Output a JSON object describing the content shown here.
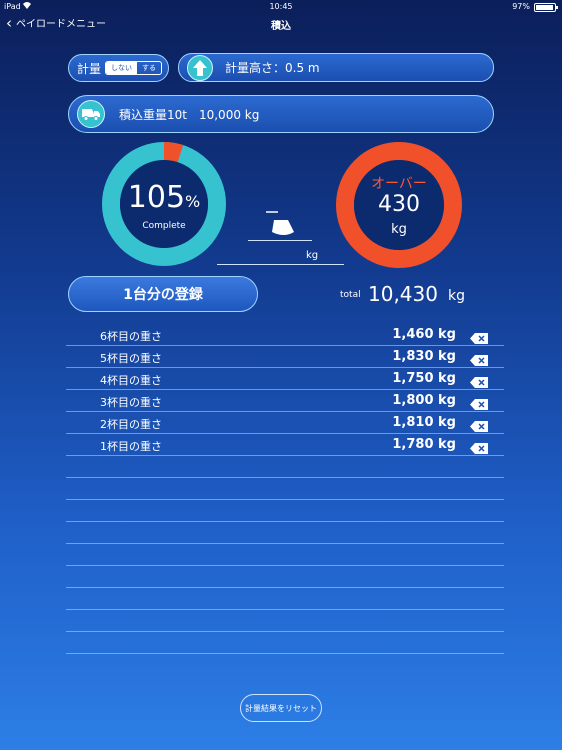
{
  "status_bar": {
    "carrier": "iPad",
    "time": "10:45",
    "battery": "97%"
  },
  "nav": {
    "back_label": "ペイロードメニュー",
    "title": "積込"
  },
  "weigh": {
    "label": "計量",
    "off": "しない",
    "on": "する"
  },
  "height": {
    "text": "計量高さ：0.5 m"
  },
  "load": {
    "text": "積込重量10t　10,000 kg"
  },
  "progress": {
    "value": "105",
    "symbol": "%",
    "caption": "Complete",
    "fraction": 1.05
  },
  "over": {
    "label": "オーバー",
    "value": "430",
    "unit": "kg"
  },
  "input_unit": "kg",
  "register_label": "1台分の登録",
  "total": {
    "label": "total",
    "value": "10,430",
    "unit": "kg"
  },
  "entries": [
    {
      "name": "6杯目の重さ",
      "weight": "1,460 kg"
    },
    {
      "name": "5杯目の重さ",
      "weight": "1,830 kg"
    },
    {
      "name": "4杯目の重さ",
      "weight": "1,750 kg"
    },
    {
      "name": "3杯目の重さ",
      "weight": "1,800 kg"
    },
    {
      "name": "2杯目の重さ",
      "weight": "1,810 kg"
    },
    {
      "name": "1杯目の重さ",
      "weight": "1,780 kg"
    }
  ],
  "reset_label": "計量結果をリセット",
  "colors": {
    "teal": "#37c2cf",
    "orange": "#f0502a",
    "navy": "#0c2a6e"
  }
}
